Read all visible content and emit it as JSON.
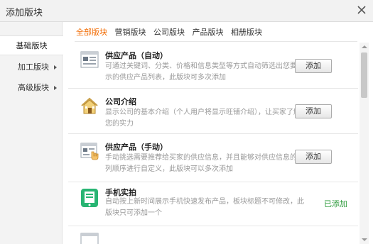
{
  "window": {
    "title": "添加版块"
  },
  "sidebar": {
    "items": [
      {
        "label": "基础版块",
        "active": true
      },
      {
        "label": "加工版块",
        "has_submenu": true
      },
      {
        "label": "高级版块",
        "has_submenu": true
      }
    ]
  },
  "tabs": [
    {
      "label": "全部版块",
      "active": true
    },
    {
      "label": "营销版块"
    },
    {
      "label": "公司版块"
    },
    {
      "label": "产品版块"
    },
    {
      "label": "相册版块"
    }
  ],
  "blocks": [
    {
      "name": "供应产品（自动）",
      "desc": "可通过关键词、分类、价格和信息类型等方式自动筛选出您要展示的供应产品列表，此版块可多次添加",
      "icon": "product-list-icon",
      "action": "添加"
    },
    {
      "name": "公司介绍",
      "desc": "显示公司的基本介绍（个人用户将显示旺铺介绍），让买家了解您的实力",
      "icon": "house-icon",
      "action": "添加"
    },
    {
      "name": "供应产品（手动）",
      "desc": "手动挑选需要推荐给买家的供应信息，并且能够对供应信息的排列顺序进行自定义，此版块可以多次添加",
      "icon": "manual-product-icon",
      "action": "添加"
    },
    {
      "name": "手机实拍",
      "desc": "自动按上新时间展示手机快速发布产品，板块标题不可修改，此版块只可添加一个",
      "icon": "mobile-phone-icon",
      "status": "已添加"
    }
  ],
  "colors": {
    "accent": "#f26a00",
    "added": "#2b9a3a"
  }
}
